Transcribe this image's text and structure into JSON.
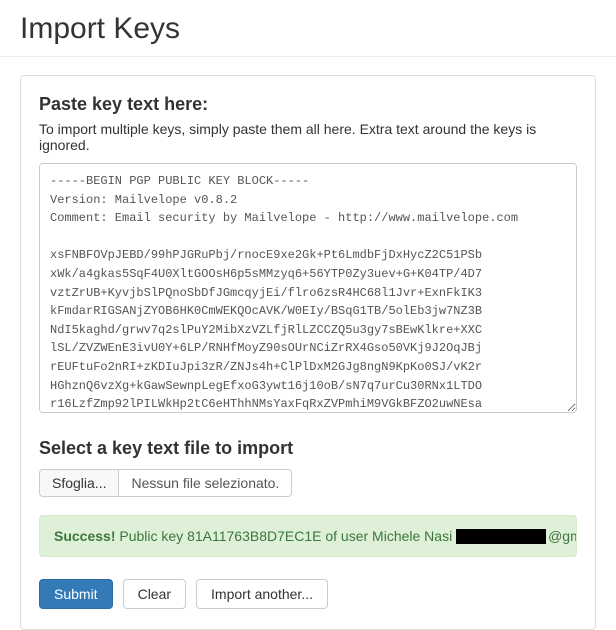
{
  "page": {
    "title": "Import Keys"
  },
  "paste": {
    "heading": "Paste key text here:",
    "help": "To import multiple keys, simply paste them all here. Extra text around the keys is ignored.",
    "value": "-----BEGIN PGP PUBLIC KEY BLOCK-----\nVersion: Mailvelope v0.8.2\nComment: Email security by Mailvelope - http://www.mailvelope.com\n\nxsFNBFOVpJEBD/99hPJGRuPbj/rnocE9xe2Gk+Pt6LmdbFjDxHycZ2C51PSb\nxWk/a4gkas5SqF4U0XltGOOsH6p5sMMzyq6+56YTP0Zy3uev+G+K04TP/4D7\nvztZrUB+KyvjbSlPQnoSbDfJGmcqyjEi/flro6zsR4HC68l1Jvr+ExnFkIK3\nkFmdarRIGSANjZYOB6HK0CmWEKQOcAVK/W0EIy/BSqG1TB/5olEb3jw7NZ3B\nNdI5kaghd/grwv7q2slPuY2MibXzVZLfjRlLZCCZQ5u3gy7sBEwKlkre+XXC\nlSL/ZVZWEnE3ivU0Y+6LP/RNHfMoyZ90sOUrNCiZrRX4Gso50VKj9J2OqJBj\nrEUFtuFo2nRI+zKDIuJpi3zR/ZNJs4h+ClPlDxM2GJg8ngN9KpKo0SJ/vK2r\nHGhznQ6vzXg+kGawSewnpLegEfxoG3ywt16j10oB/sN7q7urCu30RNx1LTDO\nr16LzfZmp92lPILWkHp2tC6eHThhNMsYaxFqRxZVPmhiM9VGkBFZO2uwNEsa"
  },
  "file": {
    "heading": "Select a key text file to import",
    "browse_label": "Sfoglia...",
    "none_label": "Nessun file selezionato."
  },
  "alert": {
    "strong": "Success!",
    "prefix": " Public key 81A11763B8D7EC1E of user Michele Nasi ",
    "suffix": "@gmail.com>"
  },
  "buttons": {
    "submit": "Submit",
    "clear": "Clear",
    "import_another": "Import another..."
  }
}
